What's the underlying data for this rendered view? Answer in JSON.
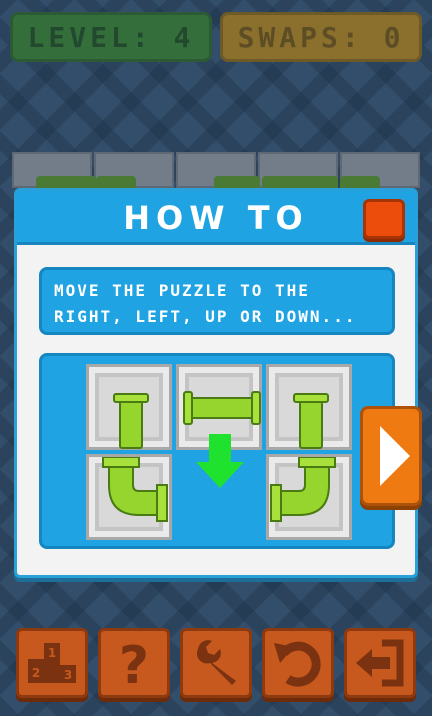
{
  "hud": {
    "level": "LEVEL: 4",
    "swaps": "SWAPS: 0"
  },
  "modal": {
    "title": "HOW TO",
    "instruction_line1": "MOVE THE PUZZLE TO THE",
    "instruction_line2": "RIGHT, LEFT, UP OR DOWN..."
  },
  "toolbar": {
    "leaderboard_icon": "podium-icon",
    "help_icon": "question-icon",
    "settings_icon": "wrench-icon",
    "undo_icon": "undo-icon",
    "exit_icon": "exit-icon"
  },
  "colors": {
    "accent_blue": "#1fa3e3",
    "pipe_green": "#96d42e",
    "button_orange": "#c8591e",
    "arrow_green": "#1ee22e"
  }
}
